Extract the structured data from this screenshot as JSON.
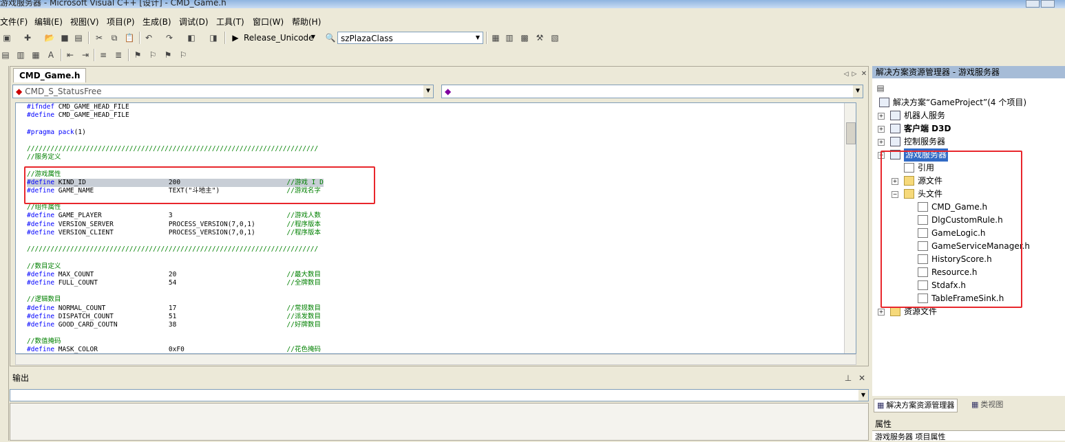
{
  "window": {
    "title": "游戏服务器 - Microsoft Visual C++ [设计] - CMD_Game.h"
  },
  "menu": [
    "文件(F)",
    "编辑(E)",
    "视图(V)",
    "项目(P)",
    "生成(B)",
    "调试(D)",
    "工具(T)",
    "窗口(W)",
    "帮助(H)"
  ],
  "toolbar": {
    "config": "Release_Unicode",
    "project": "szPlazaClass"
  },
  "editor": {
    "tab": "CMD_Game.h",
    "class_combo": "CMD_S_StatusFree",
    "member_combo": ""
  },
  "code_lines": [
    [
      {
        "c": "kw",
        "t": "#ifndef"
      },
      {
        "t": " CMD_GAME_HEAD_FILE"
      }
    ],
    [
      {
        "c": "kw",
        "t": "#define"
      },
      {
        "t": " CMD_GAME_HEAD_FILE"
      }
    ],
    [],
    [
      {
        "c": "kw",
        "t": "#pragma"
      },
      {
        "t": " "
      },
      {
        "c": "kw",
        "t": "pack"
      },
      {
        "t": "(1)"
      }
    ],
    [],
    [
      {
        "c": "cm",
        "t": "//////////////////////////////////////////////////////////////////////////"
      }
    ],
    [
      {
        "c": "cm",
        "t": "//服务定义"
      }
    ],
    [],
    [
      {
        "c": "cm",
        "t": "//游戏属性"
      }
    ],
    [
      {
        "hl": true,
        "parts": [
          {
            "c": "kw",
            "t": "#define"
          },
          {
            "t": " KIND_ID                     200                           "
          },
          {
            "c": "cm",
            "t": "//游戏 I D"
          }
        ]
      }
    ],
    [
      {
        "c": "kw",
        "t": "#define"
      },
      {
        "t": " GAME_NAME                   TEXT(\"斗地主\")                 "
      },
      {
        "c": "cm",
        "t": "//游戏名字"
      }
    ],
    [],
    [
      {
        "c": "cm",
        "t": "//组件属性"
      }
    ],
    [
      {
        "c": "kw",
        "t": "#define"
      },
      {
        "t": " GAME_PLAYER                 3                             "
      },
      {
        "c": "cm",
        "t": "//游戏人数"
      }
    ],
    [
      {
        "c": "kw",
        "t": "#define"
      },
      {
        "t": " VERSION_SERVER              PROCESS_VERSION(7,0,1)        "
      },
      {
        "c": "cm",
        "t": "//程序版本"
      }
    ],
    [
      {
        "c": "kw",
        "t": "#define"
      },
      {
        "t": " VERSION_CLIENT              PROCESS_VERSION(7,0,1)        "
      },
      {
        "c": "cm",
        "t": "//程序版本"
      }
    ],
    [],
    [
      {
        "c": "cm",
        "t": "//////////////////////////////////////////////////////////////////////////"
      }
    ],
    [],
    [
      {
        "c": "cm",
        "t": "//数目定义"
      }
    ],
    [
      {
        "c": "kw",
        "t": "#define"
      },
      {
        "t": " MAX_COUNT                   20                            "
      },
      {
        "c": "cm",
        "t": "//最大数目"
      }
    ],
    [
      {
        "c": "kw",
        "t": "#define"
      },
      {
        "t": " FULL_COUNT                  54                            "
      },
      {
        "c": "cm",
        "t": "//全牌数目"
      }
    ],
    [],
    [
      {
        "c": "cm",
        "t": "//逻辑数目"
      }
    ],
    [
      {
        "c": "kw",
        "t": "#define"
      },
      {
        "t": " NORMAL_COUNT                17                            "
      },
      {
        "c": "cm",
        "t": "//常规数目"
      }
    ],
    [
      {
        "c": "kw",
        "t": "#define"
      },
      {
        "t": " DISPATCH_COUNT              51                            "
      },
      {
        "c": "cm",
        "t": "//派发数目"
      }
    ],
    [
      {
        "c": "kw",
        "t": "#define"
      },
      {
        "t": " GOOD_CARD_COUTN             38                            "
      },
      {
        "c": "cm",
        "t": "//好牌数目"
      }
    ],
    [],
    [
      {
        "c": "cm",
        "t": "//数值掩码"
      }
    ],
    [
      {
        "c": "kw",
        "t": "#define"
      },
      {
        "t": " MASK_COLOR                  0xF0                          "
      },
      {
        "c": "cm",
        "t": "//花色掩码"
      }
    ]
  ],
  "output": {
    "title": "输出"
  },
  "solution_explorer": {
    "title": "解决方案资源管理器 - 游戏服务器",
    "solution": "解决方案“GameProject”(4 个项目)",
    "projects": [
      "机器人服务",
      "客户端 D3D",
      "控制服务器",
      "游戏服务器"
    ],
    "folders": [
      "引用",
      "源文件",
      "头文件",
      "资源文件"
    ],
    "header_files": [
      "CMD_Game.h",
      "DlgCustomRule.h",
      "GameLogic.h",
      "GameServiceManager.h",
      "HistoryScore.h",
      "Resource.h",
      "Stdafx.h",
      "TableFrameSink.h"
    ],
    "tabs": [
      "解决方案资源管理器",
      "类视图"
    ]
  },
  "properties": {
    "title": "属性",
    "subtitle": "游戏服务器 项目属性"
  },
  "colors": {
    "highlight_box": "#e8262b",
    "keyword": "#0000ff",
    "comment": "#008000"
  }
}
